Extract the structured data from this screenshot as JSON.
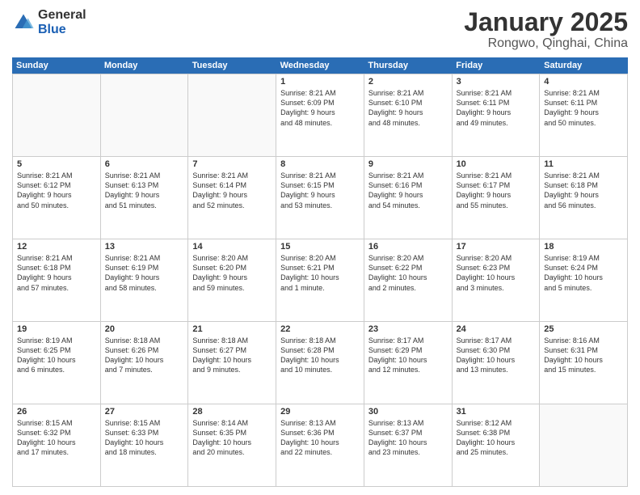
{
  "logo": {
    "general": "General",
    "blue": "Blue"
  },
  "header": {
    "title": "January 2025",
    "location": "Rongwo, Qinghai, China"
  },
  "weekdays": [
    "Sunday",
    "Monday",
    "Tuesday",
    "Wednesday",
    "Thursday",
    "Friday",
    "Saturday"
  ],
  "weeks": [
    [
      {
        "day": "",
        "content": ""
      },
      {
        "day": "",
        "content": ""
      },
      {
        "day": "",
        "content": ""
      },
      {
        "day": "1",
        "content": "Sunrise: 8:21 AM\nSunset: 6:09 PM\nDaylight: 9 hours\nand 48 minutes."
      },
      {
        "day": "2",
        "content": "Sunrise: 8:21 AM\nSunset: 6:10 PM\nDaylight: 9 hours\nand 48 minutes."
      },
      {
        "day": "3",
        "content": "Sunrise: 8:21 AM\nSunset: 6:11 PM\nDaylight: 9 hours\nand 49 minutes."
      },
      {
        "day": "4",
        "content": "Sunrise: 8:21 AM\nSunset: 6:11 PM\nDaylight: 9 hours\nand 50 minutes."
      }
    ],
    [
      {
        "day": "5",
        "content": "Sunrise: 8:21 AM\nSunset: 6:12 PM\nDaylight: 9 hours\nand 50 minutes."
      },
      {
        "day": "6",
        "content": "Sunrise: 8:21 AM\nSunset: 6:13 PM\nDaylight: 9 hours\nand 51 minutes."
      },
      {
        "day": "7",
        "content": "Sunrise: 8:21 AM\nSunset: 6:14 PM\nDaylight: 9 hours\nand 52 minutes."
      },
      {
        "day": "8",
        "content": "Sunrise: 8:21 AM\nSunset: 6:15 PM\nDaylight: 9 hours\nand 53 minutes."
      },
      {
        "day": "9",
        "content": "Sunrise: 8:21 AM\nSunset: 6:16 PM\nDaylight: 9 hours\nand 54 minutes."
      },
      {
        "day": "10",
        "content": "Sunrise: 8:21 AM\nSunset: 6:17 PM\nDaylight: 9 hours\nand 55 minutes."
      },
      {
        "day": "11",
        "content": "Sunrise: 8:21 AM\nSunset: 6:18 PM\nDaylight: 9 hours\nand 56 minutes."
      }
    ],
    [
      {
        "day": "12",
        "content": "Sunrise: 8:21 AM\nSunset: 6:18 PM\nDaylight: 9 hours\nand 57 minutes."
      },
      {
        "day": "13",
        "content": "Sunrise: 8:21 AM\nSunset: 6:19 PM\nDaylight: 9 hours\nand 58 minutes."
      },
      {
        "day": "14",
        "content": "Sunrise: 8:20 AM\nSunset: 6:20 PM\nDaylight: 9 hours\nand 59 minutes."
      },
      {
        "day": "15",
        "content": "Sunrise: 8:20 AM\nSunset: 6:21 PM\nDaylight: 10 hours\nand 1 minute."
      },
      {
        "day": "16",
        "content": "Sunrise: 8:20 AM\nSunset: 6:22 PM\nDaylight: 10 hours\nand 2 minutes."
      },
      {
        "day": "17",
        "content": "Sunrise: 8:20 AM\nSunset: 6:23 PM\nDaylight: 10 hours\nand 3 minutes."
      },
      {
        "day": "18",
        "content": "Sunrise: 8:19 AM\nSunset: 6:24 PM\nDaylight: 10 hours\nand 5 minutes."
      }
    ],
    [
      {
        "day": "19",
        "content": "Sunrise: 8:19 AM\nSunset: 6:25 PM\nDaylight: 10 hours\nand 6 minutes."
      },
      {
        "day": "20",
        "content": "Sunrise: 8:18 AM\nSunset: 6:26 PM\nDaylight: 10 hours\nand 7 minutes."
      },
      {
        "day": "21",
        "content": "Sunrise: 8:18 AM\nSunset: 6:27 PM\nDaylight: 10 hours\nand 9 minutes."
      },
      {
        "day": "22",
        "content": "Sunrise: 8:18 AM\nSunset: 6:28 PM\nDaylight: 10 hours\nand 10 minutes."
      },
      {
        "day": "23",
        "content": "Sunrise: 8:17 AM\nSunset: 6:29 PM\nDaylight: 10 hours\nand 12 minutes."
      },
      {
        "day": "24",
        "content": "Sunrise: 8:17 AM\nSunset: 6:30 PM\nDaylight: 10 hours\nand 13 minutes."
      },
      {
        "day": "25",
        "content": "Sunrise: 8:16 AM\nSunset: 6:31 PM\nDaylight: 10 hours\nand 15 minutes."
      }
    ],
    [
      {
        "day": "26",
        "content": "Sunrise: 8:15 AM\nSunset: 6:32 PM\nDaylight: 10 hours\nand 17 minutes."
      },
      {
        "day": "27",
        "content": "Sunrise: 8:15 AM\nSunset: 6:33 PM\nDaylight: 10 hours\nand 18 minutes."
      },
      {
        "day": "28",
        "content": "Sunrise: 8:14 AM\nSunset: 6:35 PM\nDaylight: 10 hours\nand 20 minutes."
      },
      {
        "day": "29",
        "content": "Sunrise: 8:13 AM\nSunset: 6:36 PM\nDaylight: 10 hours\nand 22 minutes."
      },
      {
        "day": "30",
        "content": "Sunrise: 8:13 AM\nSunset: 6:37 PM\nDaylight: 10 hours\nand 23 minutes."
      },
      {
        "day": "31",
        "content": "Sunrise: 8:12 AM\nSunset: 6:38 PM\nDaylight: 10 hours\nand 25 minutes."
      },
      {
        "day": "",
        "content": ""
      }
    ]
  ]
}
